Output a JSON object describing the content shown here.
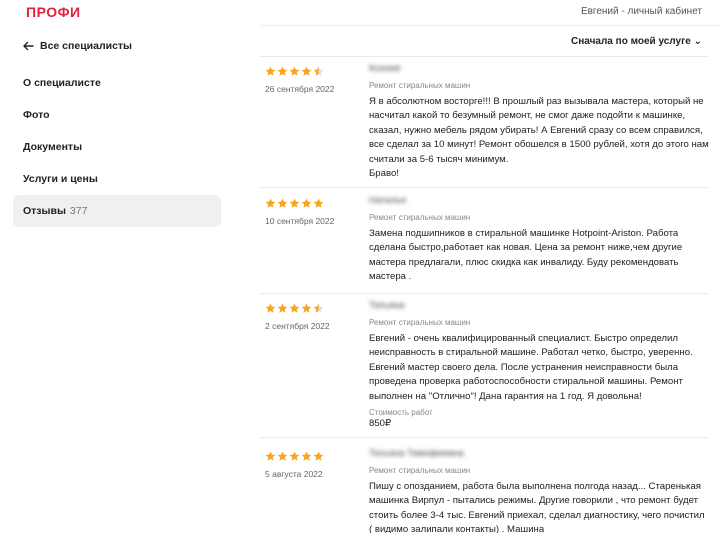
{
  "header": {
    "logo": "ПРОФИ",
    "account_link": "Евгений - личный кабинет"
  },
  "sidebar": {
    "back_label": "Все специалисты",
    "items": [
      {
        "label": "О специалисте",
        "count": ""
      },
      {
        "label": "Фото",
        "count": ""
      },
      {
        "label": "Документы",
        "count": ""
      },
      {
        "label": "Услуги и цены",
        "count": ""
      },
      {
        "label": "Отзывы",
        "count": "377",
        "active": true
      }
    ]
  },
  "sort": {
    "label": "Сначала по моей услуге"
  },
  "colors": {
    "brand": "#e3213a",
    "star": "#f5a623",
    "active_nav_bg": "#f0f0f0"
  },
  "reviews": [
    {
      "rating": 4.5,
      "date": "26 сентября 2022",
      "author": "Ксения",
      "service": "Ремонт стиральных машин",
      "text": "Я в абсолютном восторге!!! В прошлый раз вызывала мастера, который не насчитал какой то безумный ремонт, не смог даже подойти к машинке, сказал, нужно мебель рядом убирать! А Евгений сразу со всем справился, все сделал за 10 минут! Ремонт обошелся в 1500 рублей, хотя до этого нам считали за 5-6 тысяч минимум.",
      "text2": "Браво!"
    },
    {
      "rating": 5,
      "date": "10 сентября 2022",
      "author": "Наталья",
      "service": "Ремонт стиральных машин",
      "text": "Замена подшипников в стиральной машинке Hotpoint-Ariston. Работа сделана быстро,работает как новая. Цена за ремонт ниже,чем другие мастера предлагали, плюс скидка как инвалиду. Буду рекомендовать мастера ."
    },
    {
      "rating": 4.5,
      "date": "2 сентября 2022",
      "author": "Татьяна",
      "service": "Ремонт стиральных машин",
      "text": "Евгений - очень квалифицированный специалист. Быстро определил неисправность в стиральной машине. Работал четко, быстро, уверенно. Евгений мастер своего дела. После устранения неисправности была проведена проверка работоспособности стиральной машины. Ремонт выполнен на \"Отлично\"! Дана гарантия на 1 год. Я довольна!",
      "price_label": "Стоимость работ",
      "price_value": "850₽"
    },
    {
      "rating": 5,
      "date": "5 августа 2022",
      "author": "Татьяна Тимофеевна",
      "service": "Ремонт стиральных машин",
      "text": "Пишу с опозданием, работа была выполнена полгода назад... Старенькая машинка Вирпул - пытались режимы. Другие говорили , что ремонт будет стоить более 3-4 тыс. Евгений приехал, сделал диагностику, чего почистил ( видимо залипали контакты) . Машина"
    }
  ]
}
